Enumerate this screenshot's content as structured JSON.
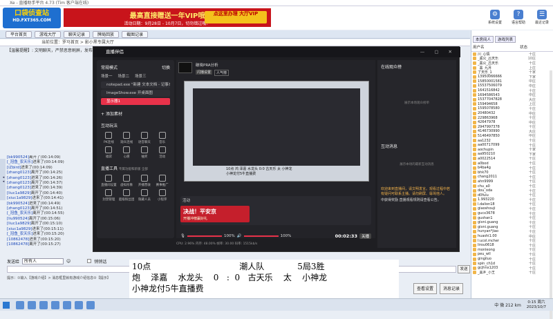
{
  "window": {
    "title": "Xe - 直播助手平台 4.73 (Tim 客户端在线)"
  },
  "banner": {
    "logo_text": "口袋侦查站",
    "logo_sub": "HD.FXT365.COM",
    "ad_line1": "最高直接赠送一年VIP哦",
    "ad_line2": "活动日期：9月28日 - 10月7日，切勿错过哦！",
    "ad_button": "点这里办理 大厅VIP",
    "icons": [
      {
        "label": "系统设置",
        "icon": "gear-icon"
      },
      {
        "label": "语言帮助",
        "icon": "help-icon"
      },
      {
        "label": "最近记录",
        "icon": "history-icon"
      }
    ]
  },
  "menubar": [
    "平台首页",
    "游戏大厅",
    "聊天记录",
    "牌局回放",
    "截图记录"
  ],
  "address": "当前位置：罗马首页 > 影小黑专属大厅",
  "ticker": "【温馨提醒】: 文明聊天，严禁恶意刷屏，发布外挂",
  "chat_lines": [
    {
      "name": "[bk990524]",
      "text": "离开了(00:14:09)"
    },
    {
      "name": "[_冠鱼_农天乐]",
      "text": "进来了(00:14:09)"
    },
    {
      "name": "[iZbird]",
      "text": "进来了(00:14:09)"
    },
    {
      "name": "[zhang0123]",
      "text": "离开了(00:14:25)"
    },
    {
      "name": "[zhang0123]",
      "text": "进来了(00:14:26)"
    },
    {
      "name": "[zhang0123]",
      "text": "离开了(00:14:37)"
    },
    {
      "name": "[zhang0123]",
      "text": "进来了(00:14:39)"
    },
    {
      "name": "[liuc1a9829]",
      "text": "离开了(00:14:40)"
    },
    {
      "name": "[xiuc1a9829]",
      "text": "进来了(00:14:41)"
    },
    {
      "name": "[bk990524]",
      "text": "进来了(00:14:49)"
    },
    {
      "name": "[zhang0123]",
      "text": "离开了(00:14:51)"
    },
    {
      "name": "[_冠鱼_农天乐]",
      "text": "离开了(00:14:55)"
    },
    {
      "name": "[liu990524]",
      "text": "离开了(00:15:06)"
    },
    {
      "name": "[liuc1a9829]",
      "text": "离开了(00:15:10)"
    },
    {
      "name": "[xiuc1a9829]",
      "text": "进来了(00:15:11)"
    },
    {
      "name": "[_冠鱼_农天乐]",
      "text": "进来了(00:15:20)"
    },
    {
      "name": "[10862478]",
      "text": "进来了(00:15:20)"
    },
    {
      "name": "[10862478]",
      "text": "离开了(00:15:27)"
    }
  ],
  "input_row": {
    "label": "发送给",
    "target": "所有人",
    "emote": "☺",
    "check_label": "悄悄话"
  },
  "hint": "提示：①输入【游戏介绍】> 消息框里就有游戏介绍信息②【提示】",
  "buttons": {
    "send": "发送",
    "clear": "清除",
    "settings": "查看设置",
    "history": "消息记录"
  },
  "right_panel": {
    "tabs": [
      "本房间人",
      "游戏列表"
    ],
    "columns": [
      "用户名",
      "状态"
    ],
    "users": [
      {
        "name": "川_心情",
        "status": "十庄"
      },
      {
        "name": "_黑公_吕天乐",
        "status": "10庄"
      },
      {
        "name": "_黑公_吕天乐",
        "status": "十庄"
      },
      {
        "name": "_黑_九月",
        "status": "上庄"
      },
      {
        "name": "了天乐_1",
        "status": "十家"
      },
      {
        "name": "13950066666",
        "status": "下家"
      },
      {
        "name": "15850001581",
        "status": "中庄"
      },
      {
        "name": "15537506079",
        "status": "中庄"
      },
      {
        "name": "1641516842",
        "status": "十庄"
      },
      {
        "name": "1694586543",
        "status": "中庄"
      },
      {
        "name": "15377047828",
        "status": "大庄"
      },
      {
        "name": "159494658",
        "status": "上庄"
      },
      {
        "name": "1595078580",
        "status": "十庄"
      },
      {
        "name": "20480432",
        "status": "中庄"
      },
      {
        "name": "229863968",
        "status": "十庄"
      },
      {
        "name": "42647978",
        "status": "中庄"
      },
      {
        "name": "2947997378",
        "status": "十庄"
      },
      {
        "name": "4146730990",
        "status": "大庄"
      },
      {
        "name": "5146497850",
        "status": "中庄"
      },
      {
        "name": "aa1232",
        "status": "十庄"
      },
      {
        "name": "aa00717099",
        "status": "十庄"
      },
      {
        "name": "aochupin",
        "status": "十家"
      },
      {
        "name": "aa950210",
        "status": "下家"
      },
      {
        "name": "a0022514",
        "status": "十庄"
      },
      {
        "name": "a0bod",
        "status": "十庄"
      },
      {
        "name": "b4ba4g",
        "status": "十庄"
      },
      {
        "name": "bhk70",
        "status": "十庄"
      },
      {
        "name": "chang2011",
        "status": "十庄"
      },
      {
        "name": "ahn9999",
        "status": "十庄"
      },
      {
        "name": "chu_a0",
        "status": "十庄"
      },
      {
        "name": "dou_oda",
        "status": "十庄"
      },
      {
        "name": "d0fulu",
        "status": "十庄"
      },
      {
        "name": "1.993220",
        "status": "十庄"
      },
      {
        "name": "l.dalion18",
        "status": "十庄"
      },
      {
        "name": "giaoshouji",
        "status": "十庄"
      },
      {
        "name": "gucx3678",
        "status": "十庄"
      },
      {
        "name": "gushan1",
        "status": "十庄"
      },
      {
        "name": "gixni.guang",
        "status": "十庄"
      },
      {
        "name": "gixni.guang",
        "status": "十庄"
      },
      {
        "name": "hunyan*jiao",
        "status": "十庄"
      },
      {
        "name": "huashi1.00",
        "status": "中庄"
      },
      {
        "name": "l:ucol.mcher",
        "status": "十庄"
      },
      {
        "name": "lirou0618",
        "status": "十庄"
      },
      {
        "name": "monleong",
        "status": "十庄"
      },
      {
        "name": "peu_wll",
        "status": "十庄"
      },
      {
        "name": "gingiluo",
        "status": "十庄"
      },
      {
        "name": "spin_ch1d",
        "status": "十庄"
      },
      {
        "name": "gcjhnx1203",
        "status": "十庄"
      },
      {
        "name": "_黑乡_小王",
        "status": "十庄"
      }
    ]
  },
  "obs": {
    "title": "直播伴侣",
    "mode": "常规模式",
    "switch": "切换",
    "scene_tabs": [
      "场景一",
      "场景二",
      "场景三"
    ],
    "sources": [
      {
        "label": "notepad.exe \"新建 文本文档 - 记事本",
        "selected": false
      },
      {
        "label": "ImageShow.exe 开桌面图",
        "selected": false
      },
      {
        "label": "显示器1",
        "selected": true
      }
    ],
    "add_source": "添加素材",
    "interact_title": "互动玩法",
    "interact_icons": [
      "PK连线",
      "观众连线",
      "语音聊天",
      "音乐",
      "福袋",
      "心愿",
      "抽奖",
      "活动"
    ],
    "tools_title": "直播工具",
    "tools_note": "专属功能和新版 全部",
    "tools_icons": [
      "直播间设置",
      "虚拟形象",
      "开播营收",
      "赛事推广",
      "封禁管理",
      "超级粉丝团",
      "隐藏人员",
      "小程序"
    ],
    "scene_name": "破晓PRA分析",
    "tag1": "闪播设置",
    "tag2": "人气榜",
    "promo_section": "活动",
    "promo_title": "决战！平安京",
    "promo_sub": "开播冲榜赢好礼",
    "mic": "100%",
    "speaker": "100%",
    "timer": "00:02:33",
    "end_button": "关播",
    "status": "CPU: 2.96%  内存: 48.00%  帧率: 30.00  码率: 1515kb/s",
    "status2": "丢帧率: 0.00%",
    "right_title": "在线观众榜",
    "empty_text": "展示本场观众榜单",
    "msg_title": "互动消息",
    "empty_msg": "展示本场的最新互动消息",
    "msgs": [
      "欢迎来到直播间，请文明发言。观看过程中若有疑问可联系主播。请勿刷屏、辱骂他人。",
      "中获得奖励 直播观看规则请查看公告。"
    ],
    "preview_caption1": "10点   鸿   泽嘉   水龙头   0:0   古天乐   太   小神龙",
    "preview_caption2": "小神龙付5牛直播费"
  },
  "overlay": {
    "line1a": "10点",
    "line1b": "潮人队",
    "line1c": "5局3胜",
    "line2": "炮    泽嘉    水龙头    0   :  0   古天乐    太    小神龙",
    "line3": "小神龙付5牛直播费"
  },
  "taskbar": {
    "time": "0:15",
    "weekday": "周六",
    "date": "2023/10/7",
    "status": "中 微 212 km"
  }
}
